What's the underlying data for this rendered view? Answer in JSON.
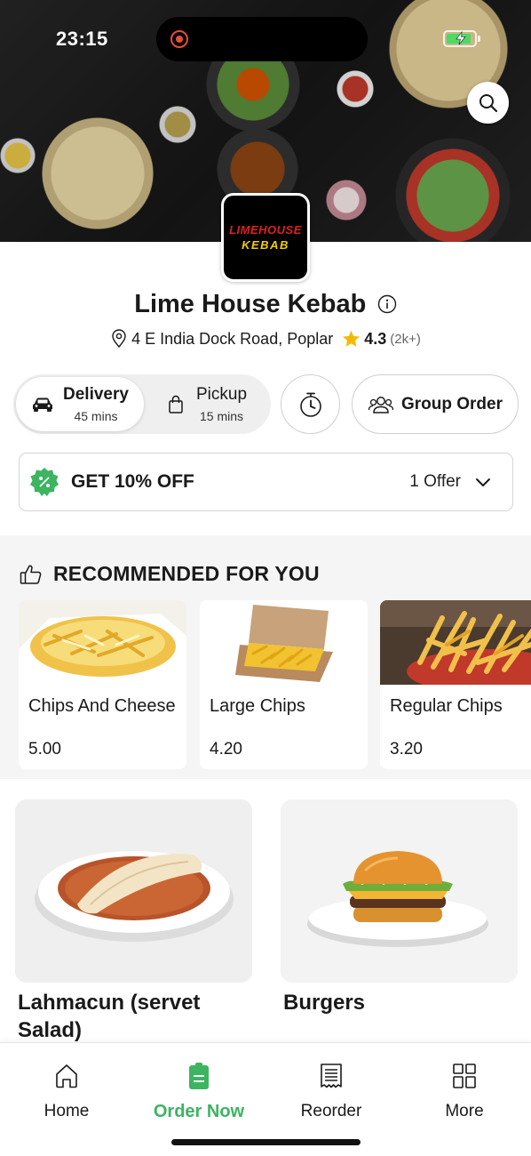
{
  "status_bar": {
    "time": "23:15",
    "battery_level": 0.9
  },
  "restaurant": {
    "logo_line1": "LIMEHOUSE",
    "logo_line2": "KEBAB",
    "name": "Lime House Kebab",
    "address": "4 E India Dock Road, Poplar",
    "rating": "4.3",
    "reviews": "(2k+)"
  },
  "order_modes": [
    {
      "label": "Delivery",
      "time": "45 mins",
      "icon": "car-icon",
      "active": true
    },
    {
      "label": "Pickup",
      "time": "15 mins",
      "icon": "bag-icon",
      "active": false
    }
  ],
  "group_order_label": "Group Order",
  "offer": {
    "title": "GET 10% OFF",
    "count": "1 Offer"
  },
  "recommended": {
    "title": "RECOMMENDED FOR YOU",
    "items": [
      {
        "name": "Chips And Cheese",
        "price": "5.00"
      },
      {
        "name": "Large Chips",
        "price": "4.20"
      },
      {
        "name": "Regular Chips",
        "price": "3.20"
      }
    ]
  },
  "categories": [
    {
      "name": "Lahmacun (servet Salad)"
    },
    {
      "name": "Burgers"
    }
  ],
  "bottom_nav": [
    {
      "label": "Home",
      "icon": "home-icon",
      "active": false
    },
    {
      "label": "Order Now",
      "icon": "order-icon",
      "active": true
    },
    {
      "label": "Reorder",
      "icon": "receipt-icon",
      "active": false
    },
    {
      "label": "More",
      "icon": "grid-icon",
      "active": false
    }
  ],
  "colors": {
    "accent": "#3cb460",
    "rating_star": "#f5b800",
    "battery": "#4cd964"
  }
}
